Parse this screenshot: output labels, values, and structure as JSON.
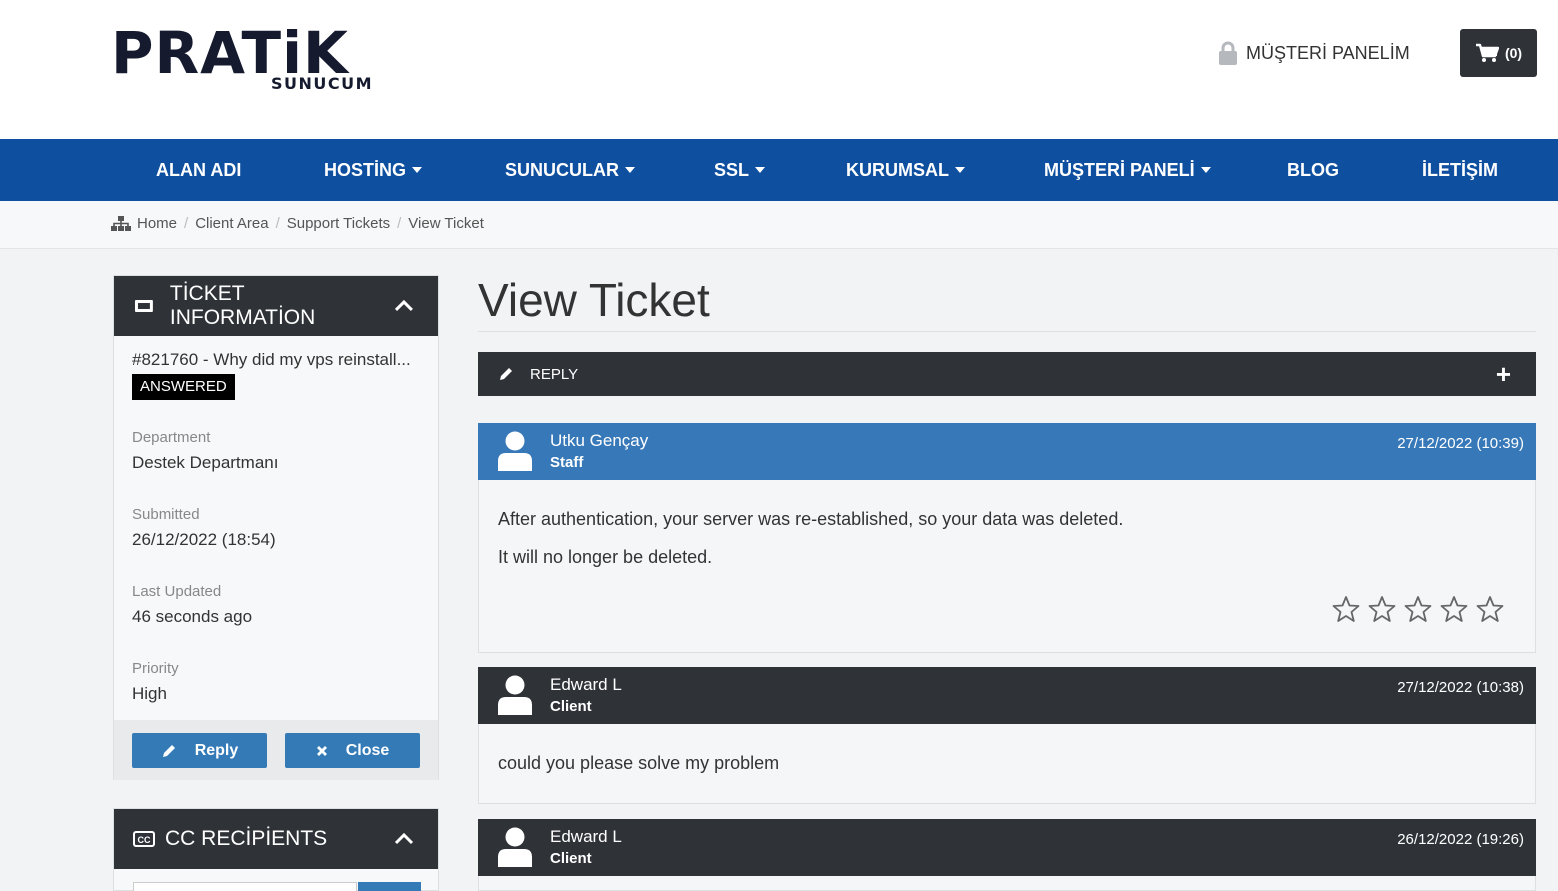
{
  "header": {
    "logo_main": "PRATiK",
    "logo_sub": "SUNUCUM",
    "panel_link": "MÜŞTERİ PANELİM",
    "cart_count": "(0)"
  },
  "nav": {
    "items": [
      {
        "label": "ALAN ADI"
      },
      {
        "label": "HOSTİNG"
      },
      {
        "label": "SUNUCULAR"
      },
      {
        "label": "SSL"
      },
      {
        "label": "KURUMSAL"
      },
      {
        "label": "MÜŞTERİ PANELİ"
      },
      {
        "label": "BLOG"
      },
      {
        "label": "İLETİŞİM"
      }
    ]
  },
  "breadcrumb": [
    "Home",
    "Client Area",
    "Support Tickets",
    "View Ticket"
  ],
  "ticket_info": {
    "title": "TİCKET INFORMATİON",
    "subject": "#821760 - Why did my vps reinstall...",
    "status": "ANSWERED",
    "department_label": "Department",
    "department": "Destek Departmanı",
    "submitted_label": "Submitted",
    "submitted": "26/12/2022 (18:54)",
    "updated_label": "Last Updated",
    "updated": "46 seconds ago",
    "priority_label": "Priority",
    "priority": "High",
    "reply_button": "Reply",
    "close_button": "Close"
  },
  "cc_panel": {
    "title": "CC RECİPİENTS"
  },
  "main": {
    "title": "View Ticket",
    "reply_bar": "REPLY"
  },
  "messages": [
    {
      "author": "Utku Gençay",
      "role": "Staff",
      "date": "27/12/2022 (10:39)",
      "lines": [
        "After authentication, your server was re-established, so your data was deleted.",
        "It will no longer be deleted."
      ]
    },
    {
      "author": "Edward L",
      "role": "Client",
      "date": "27/12/2022 (10:38)",
      "lines": [
        "could you please solve my problem"
      ]
    },
    {
      "author": "Edward L",
      "role": "Client",
      "date": "26/12/2022 (19:26)",
      "lines": []
    }
  ],
  "colors": {
    "nav_blue": "#0f4fa0",
    "staff_blue": "#3778b8",
    "dark_header": "#2f3338",
    "button_blue": "#337ab7"
  }
}
